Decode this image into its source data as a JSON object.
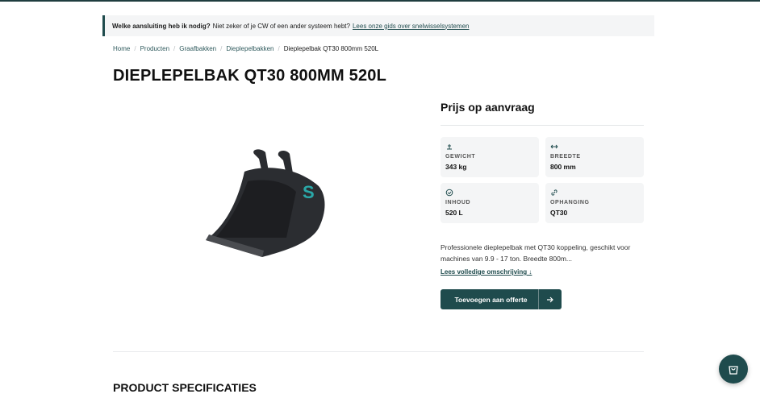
{
  "notice": {
    "question": "Welke aansluiting heb ik nodig?",
    "text": "Niet zeker of je CW of een ander systeem hebt?",
    "link": "Lees onze gids over snelwisselsystemen"
  },
  "breadcrumb": [
    "Home",
    "Producten",
    "Graafbakken",
    "Dieplepelbakken",
    "Dieplepelbak QT30 800mm 520L"
  ],
  "page_title": "DIEPLEPELBAK QT30 800MM 520L",
  "price": "Prijs op aanvraag",
  "specs": [
    {
      "icon": "weight-icon",
      "label": "GEWICHT",
      "value": "343 kg"
    },
    {
      "icon": "width-arrows-icon",
      "label": "BREEDTE",
      "value": "800 mm"
    },
    {
      "icon": "volume-icon",
      "label": "INHOUD",
      "value": "520 L"
    },
    {
      "icon": "link-icon",
      "label": "OPHANGING",
      "value": "QT30"
    }
  ],
  "description": "Professionele dieplepelbak met QT30 koppeling, geschikt voor machines van 9.9 - 17 ton. Breedte 800m...",
  "read_more": "Lees volledige omschrijving ↓",
  "cta": "Toevoegen aan offerte",
  "section_title": "PRODUCT SPECIFICATIES",
  "colors": {
    "brand": "#1f4b4d",
    "accent_logo": "#2aa8a8",
    "panel": "#f4f5f6"
  }
}
